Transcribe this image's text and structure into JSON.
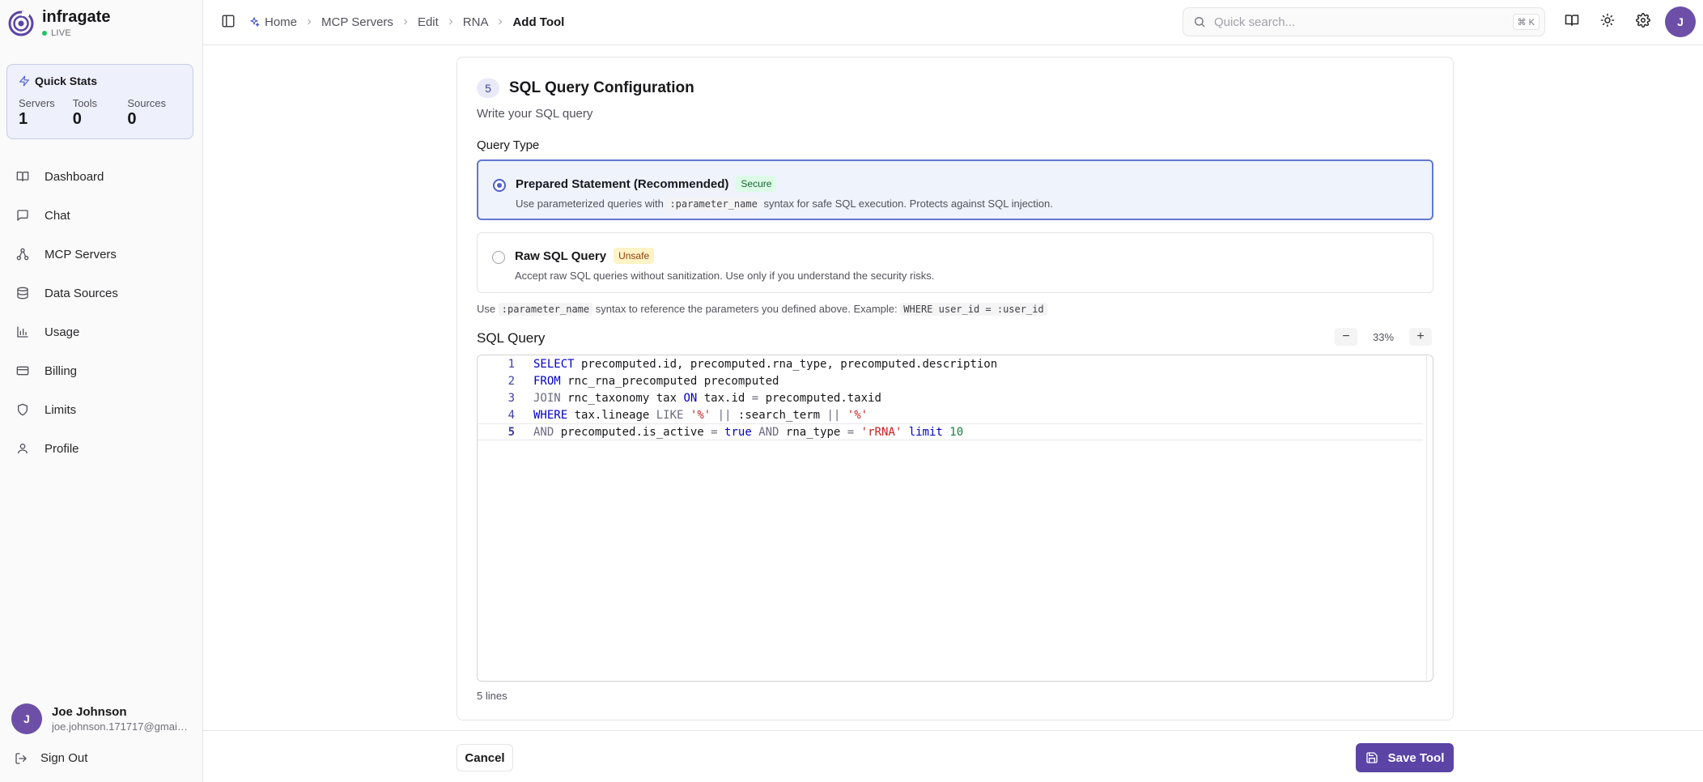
{
  "brand": {
    "name": "infragate",
    "status": "LIVE"
  },
  "quick_stats": {
    "title": "Quick Stats",
    "items": [
      {
        "label": "Servers",
        "value": "1"
      },
      {
        "label": "Tools",
        "value": "0"
      },
      {
        "label": "Sources",
        "value": "0"
      }
    ]
  },
  "sidebar": {
    "items": [
      {
        "label": "Dashboard",
        "icon": "book-open-icon"
      },
      {
        "label": "Chat",
        "icon": "message-square-icon"
      },
      {
        "label": "MCP Servers",
        "icon": "network-icon"
      },
      {
        "label": "Data Sources",
        "icon": "database-icon"
      },
      {
        "label": "Usage",
        "icon": "bar-chart-icon"
      },
      {
        "label": "Billing",
        "icon": "credit-card-icon"
      },
      {
        "label": "Limits",
        "icon": "shield-icon"
      },
      {
        "label": "Profile",
        "icon": "user-icon"
      }
    ]
  },
  "user": {
    "initial": "J",
    "name": "Joe Johnson",
    "email": "joe.johnson.171717@gmail.com"
  },
  "signout_label": "Sign Out",
  "breadcrumb": [
    "Home",
    "MCP Servers",
    "Edit",
    "RNA",
    "Add Tool"
  ],
  "search": {
    "placeholder": "Quick search...",
    "shortcut": "⌘ K"
  },
  "header_avatar": "J",
  "section": {
    "number": "5",
    "title": "SQL Query Configuration",
    "subtitle": "Write your SQL query",
    "query_type_label": "Query Type"
  },
  "options": {
    "prepared": {
      "title": "Prepared Statement (Recommended)",
      "badge": "Secure",
      "desc_before": "Use parameterized queries with",
      "desc_code": ":parameter_name",
      "desc_after": "syntax for safe SQL execution. Protects against SQL injection.",
      "selected": true
    },
    "raw": {
      "title": "Raw SQL Query",
      "badge": "Unsafe",
      "desc": "Accept raw SQL queries without sanitization. Use only if you understand the security risks.",
      "selected": false
    }
  },
  "hint": {
    "before": "Use",
    "code1": ":parameter_name",
    "middle": "syntax to reference the parameters you defined above. Example:",
    "code2": "WHERE user_id = :user_id"
  },
  "editor": {
    "label": "SQL Query",
    "zoom": "33%",
    "lines": [
      "SELECT precomputed.id, precomputed.rna_type, precomputed.description",
      "FROM rnc_rna_precomputed precomputed",
      "JOIN rnc_taxonomy tax ON tax.id = precomputed.taxid",
      "WHERE tax.lineage LIKE '%' || :search_term || '%'",
      "AND precomputed.is_active = true AND rna_type = 'rRNA' limit 10"
    ],
    "line_count_label": "5 lines"
  },
  "footer": {
    "cancel_label": "Cancel",
    "save_label": "Save Tool"
  },
  "colors": {
    "accent": "#5b44a6",
    "selected_border": "#6377cf",
    "secure": "#166534",
    "unsafe": "#92400e"
  }
}
